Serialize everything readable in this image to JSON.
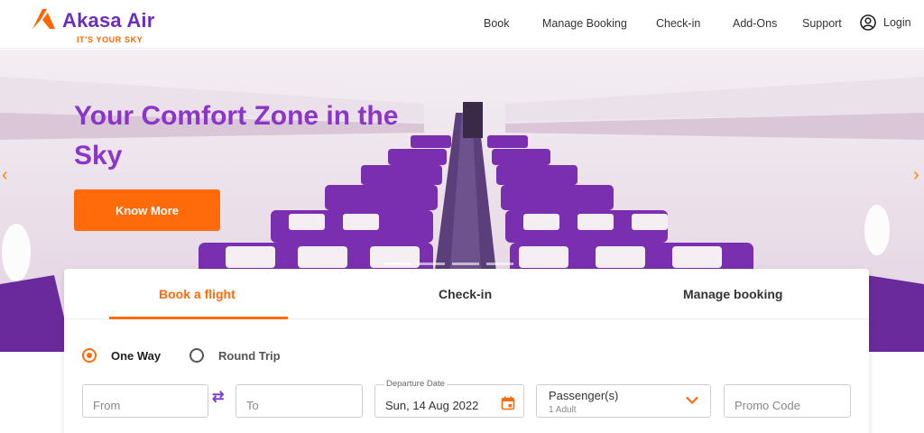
{
  "brand": {
    "name": "Akasa Air",
    "tagline": "IT'S YOUR SKY",
    "primary_color": "#6a2fc1",
    "accent_color": "#ff6a0a"
  },
  "nav": {
    "items": [
      "Book",
      "Manage Booking",
      "Check-in",
      "Add-Ons",
      "Support"
    ],
    "login_label": "Login",
    "login_icon": "user-circle-icon"
  },
  "hero": {
    "title": "Your Comfort Zone in the Sky",
    "cta_label": "Know More",
    "prev_arrow": "‹",
    "next_arrow": "›",
    "slides": {
      "count": 4,
      "active": 3
    }
  },
  "booking": {
    "tabs": [
      "Book a flight",
      "Check-in",
      "Manage booking"
    ],
    "active_tab": 0,
    "trip_types": [
      "One Way",
      "Round Trip"
    ],
    "selected_trip": "One Way",
    "from_placeholder": "From",
    "to_placeholder": "To",
    "swap_icon": "⇄",
    "departure_label": "Departure Date",
    "departure_value": "Sun, 14 Aug 2022",
    "calendar_icon": "calendar-icon",
    "passengers_label": "Passenger(s)",
    "passengers_value": "1 Adult",
    "promo_placeholder": "Promo Code"
  }
}
